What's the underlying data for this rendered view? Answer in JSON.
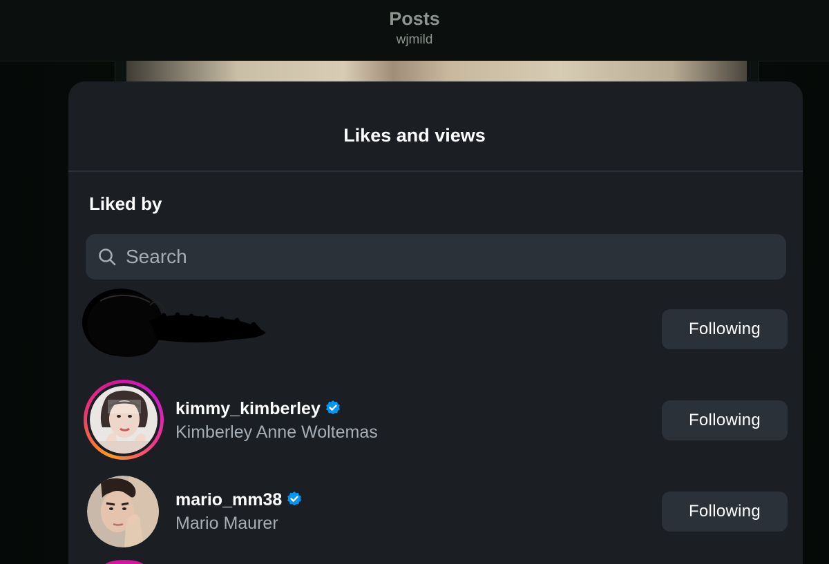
{
  "header": {
    "title": "Posts",
    "subtitle": "wjmild"
  },
  "sheet": {
    "title": "Likes and views",
    "section_heading": "Liked by",
    "search": {
      "placeholder": "Search",
      "value": ""
    }
  },
  "likers": [
    {
      "username": "",
      "full_name": "",
      "redacted": true,
      "verified": false,
      "has_story": false,
      "button_label": "Following"
    },
    {
      "username": "kimmy_kimberley",
      "full_name": "Kimberley Anne Woltemas",
      "redacted": false,
      "verified": true,
      "has_story": true,
      "button_label": "Following"
    },
    {
      "username": "mario_mm38",
      "full_name": "Mario Maurer",
      "redacted": false,
      "verified": true,
      "has_story": false,
      "button_label": "Following"
    }
  ],
  "colors": {
    "sheet_background": "#1b1f24",
    "button_background": "#2b3138",
    "secondary_text": "#a6adb5",
    "verified_badge": "#0095f6",
    "story_ring_start": "#ff9a1f",
    "story_ring_end": "#c51fc4"
  },
  "icons": {
    "search": "search-icon",
    "verified": "verified-badge-icon"
  }
}
